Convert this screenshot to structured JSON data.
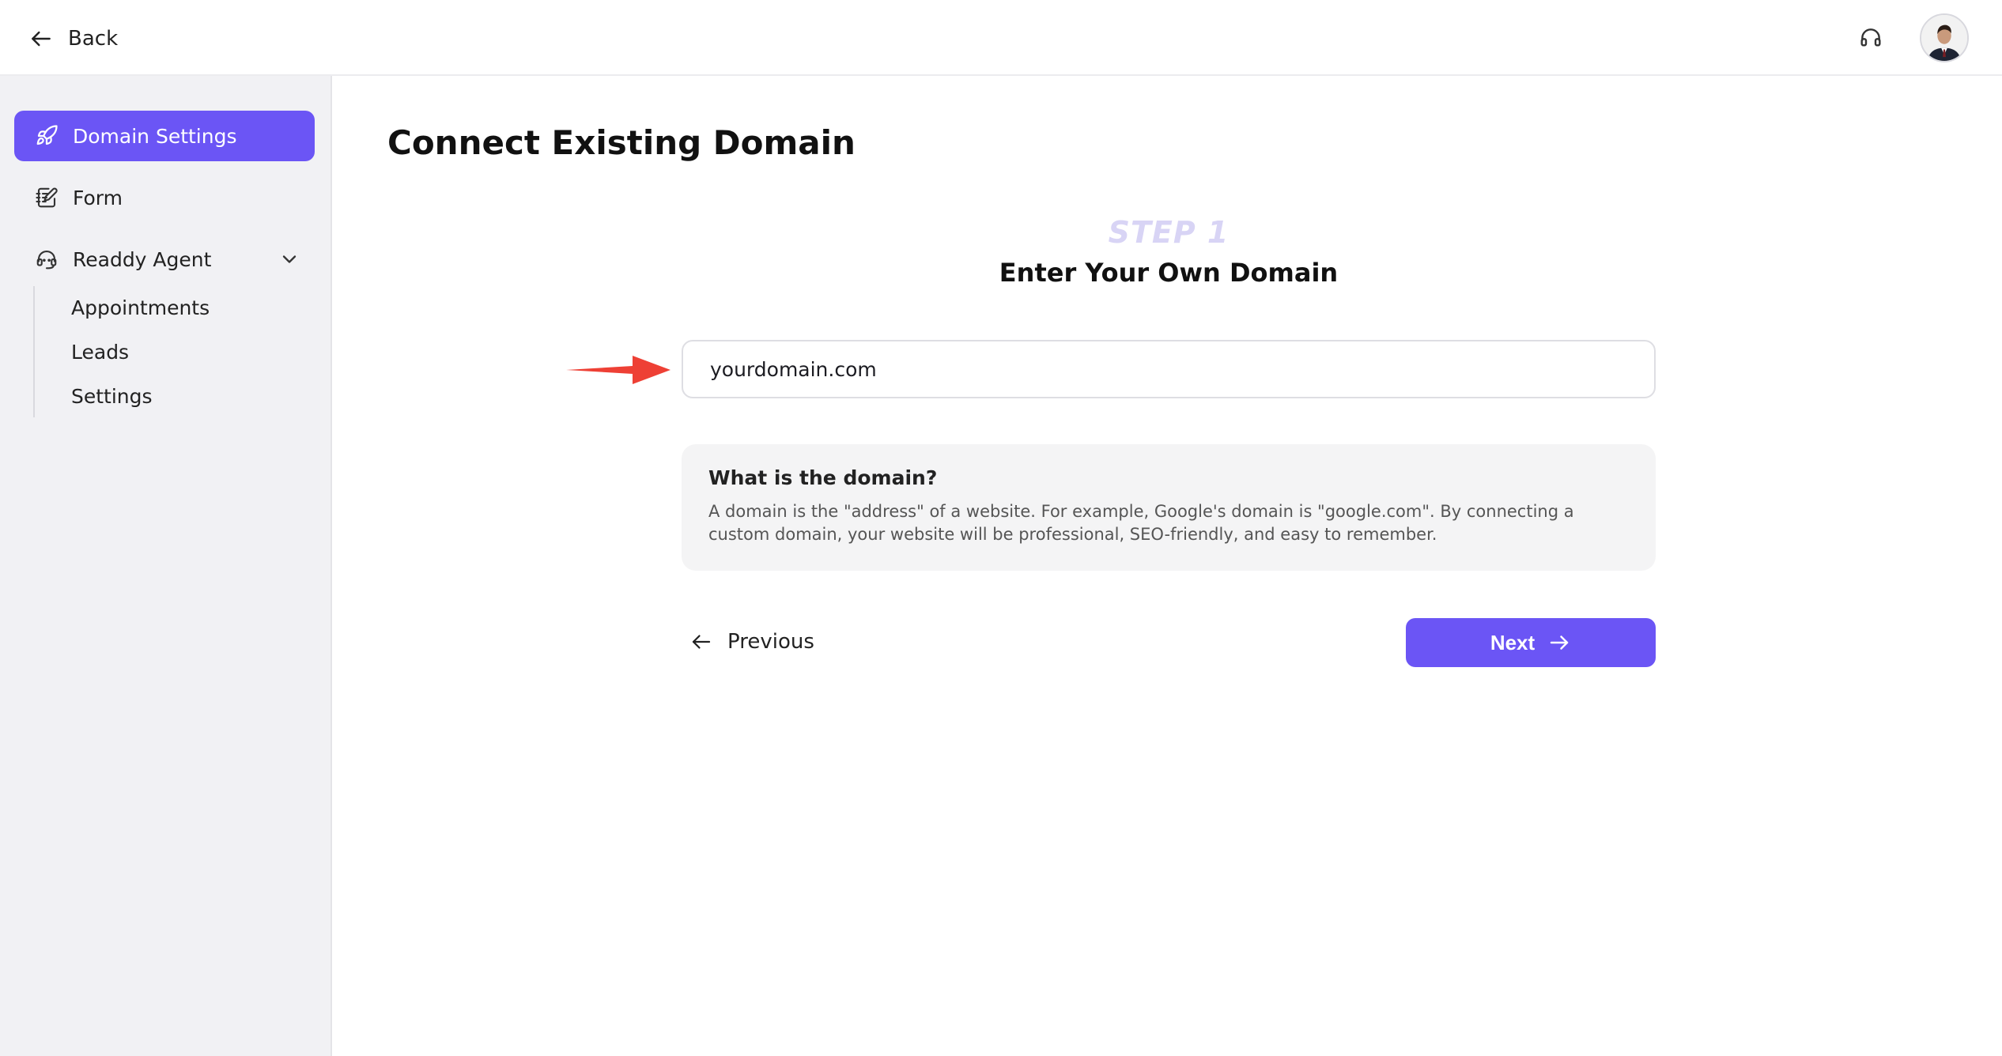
{
  "topbar": {
    "back_label": "Back",
    "support_icon": "headset-icon",
    "avatar_icon": "user-avatar"
  },
  "sidebar": {
    "items": [
      {
        "label": "Domain Settings",
        "icon": "rocket-icon",
        "active": true
      },
      {
        "label": "Form",
        "icon": "edit-form-icon",
        "active": false
      },
      {
        "label": "Readdy Agent",
        "icon": "agent-headset-icon",
        "active": false,
        "expanded": true
      }
    ],
    "subitems": [
      {
        "label": "Appointments"
      },
      {
        "label": "Leads"
      },
      {
        "label": "Settings"
      }
    ]
  },
  "main": {
    "title": "Connect Existing Domain",
    "step_label": "STEP 1",
    "step_title": "Enter Your Own Domain",
    "domain_input": {
      "value": "yourdomain.com",
      "placeholder": ""
    },
    "info": {
      "title": "What is the domain?",
      "body": "A domain is the \"address\" of a website. For example, Google's domain is \"google.com\". By connecting a custom domain, your website will be professional, SEO-friendly, and easy to remember."
    },
    "previous_label": "Previous",
    "next_label": "Next"
  },
  "colors": {
    "accent": "#6b55f5",
    "sidebar_bg": "#f1f1f4",
    "annotation_arrow": "#ee4035",
    "step_label": "#d8d4f5"
  }
}
